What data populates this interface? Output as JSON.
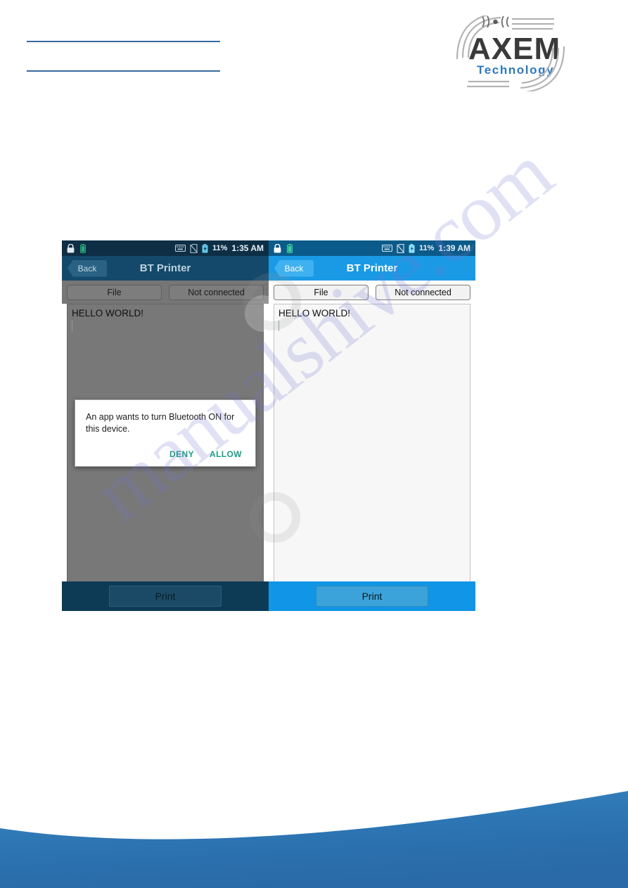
{
  "document": {
    "brand": {
      "name": "AXEM",
      "tagline": "Technology",
      "name_color": "#3a3a3a",
      "tagline_color": "#2f78bd",
      "swoosh_color": "#b3b3b3"
    },
    "header_rule_color": "#35699e",
    "wave_color": "#2a6fb0",
    "watermark": "manualshive.com"
  },
  "screenshots": [
    {
      "id": "left",
      "state": "bluetooth-permission-dialog",
      "dimmed": true,
      "statusbar": {
        "lock_icon": "lock-icon",
        "battery_icon": "battery-icon",
        "keyboard_icon": "keyboard-icon",
        "sim_icon": "no-sim-icon",
        "charging_icon": "charging-battery-icon",
        "battery_percent": "11%",
        "time": "1:35 AM"
      },
      "appbar": {
        "back_label": "Back",
        "title": "BT Printer"
      },
      "toolbar": {
        "file_label": "File",
        "status_label": "Not connected"
      },
      "content": {
        "text": "HELLO WORLD!"
      },
      "bottom": {
        "print_label": "Print"
      },
      "dialog": {
        "message": "An app wants to turn Bluetooth ON for this device.",
        "deny_label": "DENY",
        "allow_label": "ALLOW",
        "action_color": "#1a9e84"
      }
    },
    {
      "id": "right",
      "state": "connected-idle",
      "dimmed": false,
      "statusbar": {
        "lock_icon": "lock-icon",
        "battery_icon": "battery-icon",
        "keyboard_icon": "keyboard-icon",
        "sim_icon": "no-sim-icon",
        "charging_icon": "charging-battery-icon",
        "battery_percent": "11%",
        "time": "1:39 AM"
      },
      "appbar": {
        "back_label": "Back",
        "title": "BT Printer"
      },
      "toolbar": {
        "file_label": "File",
        "status_label": "Not connected"
      },
      "content": {
        "text": "HELLO WORLD!"
      },
      "bottom": {
        "print_label": "Print"
      },
      "dialog": null
    }
  ]
}
